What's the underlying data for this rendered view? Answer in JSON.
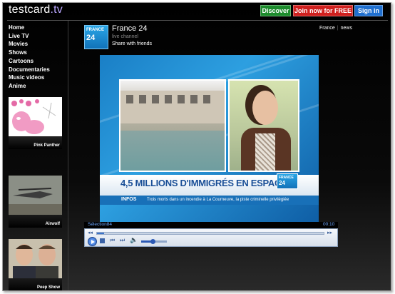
{
  "header": {
    "logo_main": "testcard",
    "logo_tld": ".tv",
    "buttons": {
      "discover": "Discover",
      "join": "Join now for FREE",
      "signin": "Sign in"
    }
  },
  "sidebar": {
    "nav": [
      "Home",
      "Live TV",
      "Movies",
      "Shows",
      "Cartoons",
      "Documentaries",
      "Music videos",
      "Anime"
    ],
    "thumbnails": [
      {
        "label": "Pink Panther"
      },
      {
        "label": "Airwolf"
      },
      {
        "label": "Peep Show"
      }
    ]
  },
  "channel": {
    "logo_line1": "FRANCE",
    "logo_line2": "24",
    "title": "France 24",
    "subtitle": "live channel",
    "share": "Share with friends",
    "tags": [
      "France",
      "news"
    ]
  },
  "video": {
    "headline": "4,5 MILLIONS D'IMMIGRÉS EN ESPAGNE",
    "badge_line1": "FRANCE",
    "badge_line2": "24",
    "ticker_label": "INFOS",
    "ticker_text": "Trois morts dans un incendie à La Courneuve, la piste criminelle privilégiée"
  },
  "player": {
    "clip_title": "Sélection84",
    "time": "00:10",
    "seek_progress": 0.03,
    "volume_level": 0.45,
    "icons": [
      "play-icon",
      "stop-icon",
      "previous-icon",
      "next-icon",
      "volume-icon"
    ]
  },
  "colors": {
    "discover": "#1c8c2c",
    "join": "#d0201e",
    "signin": "#1f6fcf",
    "tld": "#b9a6ff",
    "france24_blue": "#1870b8"
  }
}
